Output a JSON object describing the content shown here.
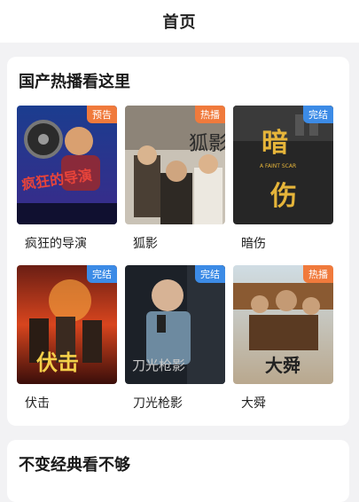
{
  "header": {
    "title": "首页"
  },
  "sections": [
    {
      "title": "国产热播看这里",
      "items": [
        {
          "name": "疯狂的导演",
          "badge": "预告",
          "badge_type": "trailer",
          "poster_text": "疯狂的导演"
        },
        {
          "name": "狐影",
          "badge": "热播",
          "badge_type": "hot",
          "poster_text": "狐影"
        },
        {
          "name": "暗伤",
          "badge": "完结",
          "badge_type": "done",
          "poster_text": "暗伤",
          "poster_subtext": "A FAINT SCAR"
        },
        {
          "name": "伏击",
          "badge": "完结",
          "badge_type": "done",
          "poster_text": "伏击"
        },
        {
          "name": "刀光枪影",
          "badge": "完结",
          "badge_type": "done",
          "poster_text": "刀光枪影"
        },
        {
          "name": "大舜",
          "badge": "热播",
          "badge_type": "hot",
          "poster_text": "大舜"
        }
      ]
    },
    {
      "title": "不变经典看不够"
    }
  ],
  "colors": {
    "hot": "#f07a3c",
    "done": "#3c8be6",
    "background": "#f2f2f4"
  }
}
